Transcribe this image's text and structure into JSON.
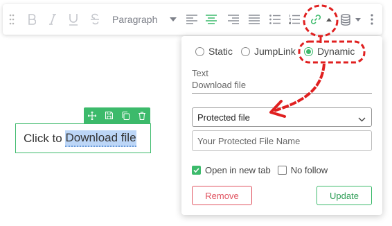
{
  "toolbar": {
    "paragraph_label": "Paragraph",
    "icons": [
      "drag-handle-icon",
      "bold-icon",
      "italic-icon",
      "underline-icon",
      "strikethrough-icon",
      "chevron-down-icon",
      "align-left-icon",
      "align-center-icon",
      "align-right-icon",
      "align-justify-icon",
      "bulleted-list-icon",
      "numbered-list-icon",
      "link-icon",
      "caret-up-icon",
      "database-icon",
      "more-vertical-icon"
    ],
    "active_color": "#3cba6b"
  },
  "block": {
    "text_before": "Click to ",
    "selected_text": "Download file",
    "controls": [
      "move-icon",
      "save-icon",
      "copy-icon",
      "delete-icon"
    ]
  },
  "popover": {
    "link_types": {
      "static": "Static",
      "jumplink": "JumpLink",
      "dynamic": "Dynamic",
      "selected": "dynamic"
    },
    "text_field": {
      "label": "Text",
      "value": "Download file"
    },
    "source_select": {
      "value": "Protected file"
    },
    "file_name_input": {
      "placeholder": "Your Protected File Name"
    },
    "open_new_tab": {
      "label": "Open in new tab",
      "checked": true
    },
    "no_follow": {
      "label": "No follow",
      "checked": false
    },
    "remove_label": "Remove",
    "update_label": "Update"
  },
  "colors": {
    "accent": "#3cba6b",
    "danger": "#e0525f",
    "annotation": "#e02020",
    "selection": "#bcd6f7"
  }
}
